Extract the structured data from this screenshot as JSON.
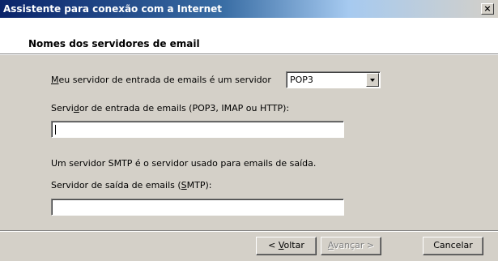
{
  "window": {
    "title": "Assistente para conexão com a Internet",
    "close_label": "×"
  },
  "header": {
    "title": "Nomes dos servidores de email"
  },
  "form": {
    "incoming_type_label_accel": "M",
    "incoming_type_label_rest": "eu servidor de entrada de emails é um  servidor",
    "incoming_type_value": "POP3",
    "incoming_server_label_pre": "Servi",
    "incoming_server_label_accel": "d",
    "incoming_server_label_post": "or de entrada de emails (POP3, IMAP ou HTTP):",
    "incoming_server_value": "",
    "smtp_info": "Um servidor SMTP é o servidor usado para emails de saída.",
    "outgoing_server_label_pre": "Servidor de saída de emails (",
    "outgoing_server_label_accel": "S",
    "outgoing_server_label_post": "MTP):",
    "outgoing_server_value": ""
  },
  "buttons": {
    "back_pre": "< ",
    "back_accel": "V",
    "back_post": "oltar",
    "next_accel": "A",
    "next_post": "vançar >",
    "cancel": "Cancelar"
  }
}
